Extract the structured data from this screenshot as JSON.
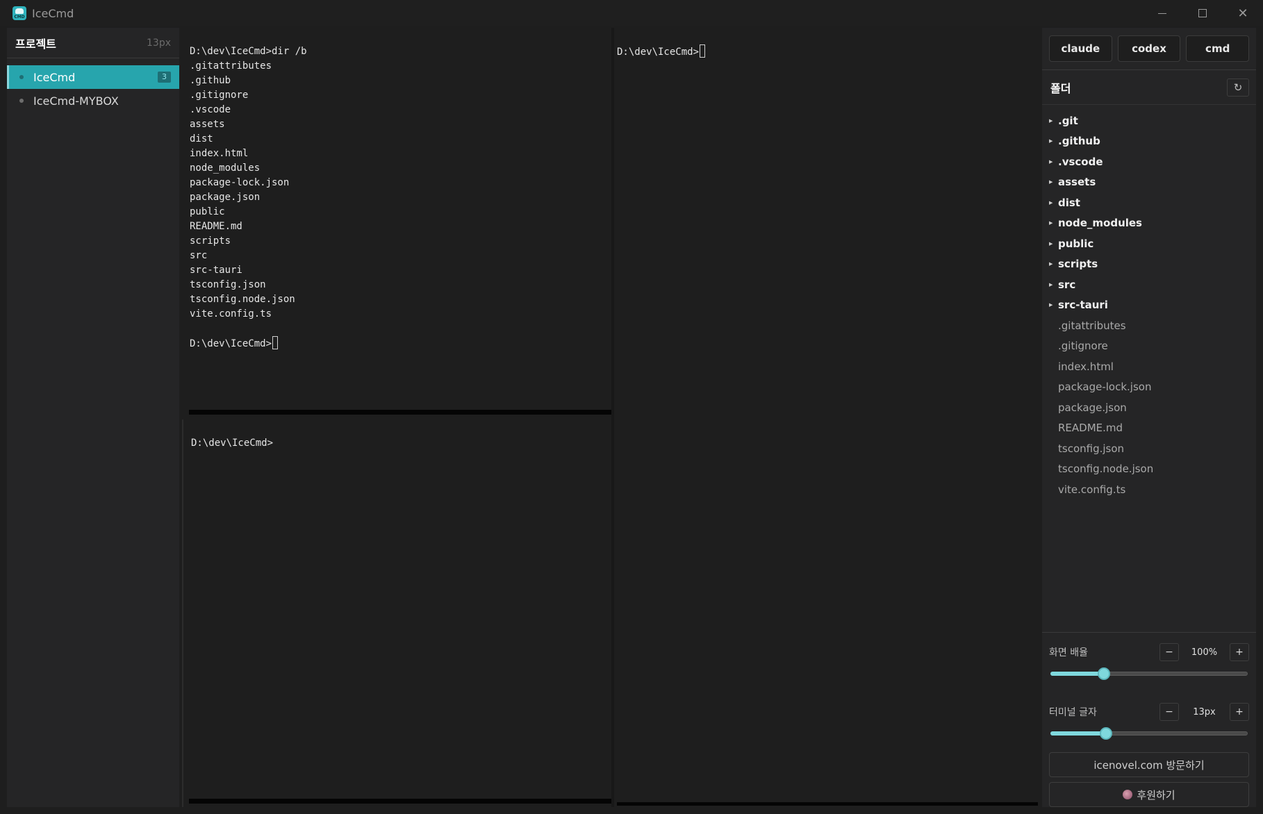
{
  "window": {
    "title": "IceCmd",
    "logo_text": "CMD",
    "controls": [
      "minimize",
      "maximize",
      "close"
    ]
  },
  "sidebar": {
    "title": "프로젝트",
    "font_size": "13px",
    "projects": [
      {
        "name": "IceCmd",
        "badge": "3",
        "active": true
      },
      {
        "name": "IceCmd-MYBOX",
        "badge": "",
        "active": false
      }
    ]
  },
  "terminals": {
    "top_left": {
      "lines": [
        "D:\\dev\\IceCmd>dir /b",
        ".gitattributes",
        ".github",
        ".gitignore",
        ".vscode",
        "assets",
        "dist",
        "index.html",
        "node_modules",
        "package-lock.json",
        "package.json",
        "public",
        "README.md",
        "scripts",
        "src",
        "src-tauri",
        "tsconfig.json",
        "tsconfig.node.json",
        "vite.config.ts",
        ""
      ],
      "prompt": "D:\\dev\\IceCmd>"
    },
    "bottom_left": {
      "prompt": "D:\\dev\\IceCmd>"
    },
    "right": {
      "prompt": "D:\\dev\\IceCmd>"
    }
  },
  "right_panel": {
    "agents": [
      "claude",
      "codex",
      "cmd"
    ],
    "folder_title": "폴더",
    "refresh_icon": "↻",
    "tree": [
      {
        "name": ".git",
        "type": "dir"
      },
      {
        "name": ".github",
        "type": "dir"
      },
      {
        "name": ".vscode",
        "type": "dir"
      },
      {
        "name": "assets",
        "type": "dir"
      },
      {
        "name": "dist",
        "type": "dir"
      },
      {
        "name": "node_modules",
        "type": "dir"
      },
      {
        "name": "public",
        "type": "dir"
      },
      {
        "name": "scripts",
        "type": "dir"
      },
      {
        "name": "src",
        "type": "dir"
      },
      {
        "name": "src-tauri",
        "type": "dir"
      },
      {
        "name": ".gitattributes",
        "type": "file"
      },
      {
        "name": ".gitignore",
        "type": "file"
      },
      {
        "name": "index.html",
        "type": "file"
      },
      {
        "name": "package-lock.json",
        "type": "file"
      },
      {
        "name": "package.json",
        "type": "file"
      },
      {
        "name": "README.md",
        "type": "file"
      },
      {
        "name": "tsconfig.json",
        "type": "file"
      },
      {
        "name": "tsconfig.node.json",
        "type": "file"
      },
      {
        "name": "vite.config.ts",
        "type": "file"
      }
    ],
    "zoom": {
      "label": "화면 배율",
      "value": "100%",
      "fraction": 0.27,
      "minus": "−",
      "plus": "+"
    },
    "term_font": {
      "label": "터미널 글자",
      "value": "13px",
      "fraction": 0.28,
      "minus": "−",
      "plus": "+"
    },
    "visit_label": "icenovel.com 방문하기",
    "donate_label": "후원하기"
  },
  "colors": {
    "accent": "#27a5ad",
    "slider": "#7fd8dd"
  }
}
